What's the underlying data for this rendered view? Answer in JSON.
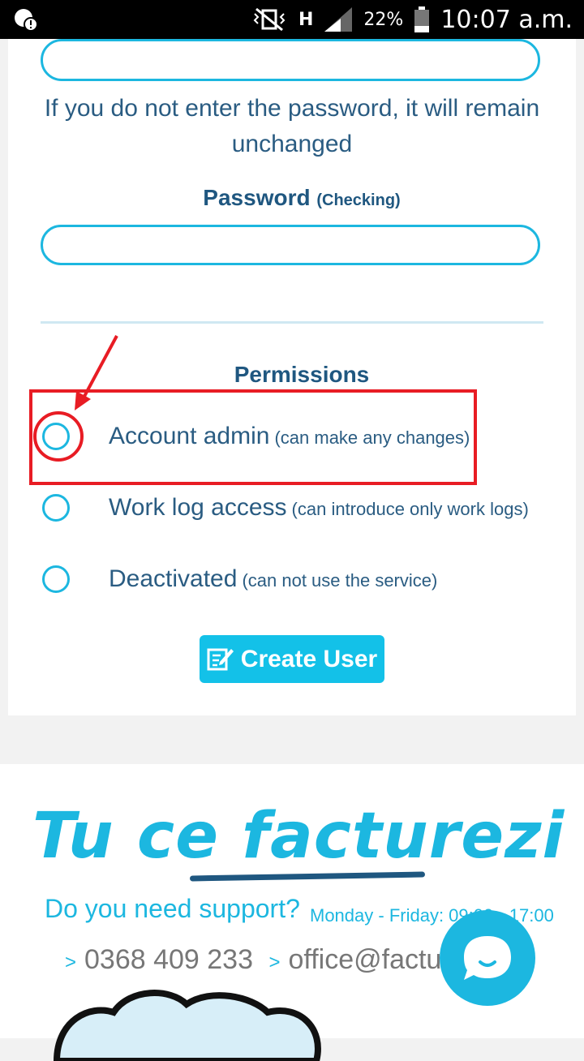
{
  "status_bar": {
    "battery": "22%",
    "time": "10:07 a.m.",
    "network_indicator": "H"
  },
  "form": {
    "password_note": "If you do not enter the password, it will remain unchanged",
    "password_check_label": "Password",
    "password_check_sub": "(Checking)",
    "password_value": "",
    "password_check_value": "",
    "permissions_title": "Permissions",
    "options": [
      {
        "label": "Account admin",
        "sub": "(can make any changes)"
      },
      {
        "label": "Work log access",
        "sub": "(can introduce only work logs)"
      },
      {
        "label": "Deactivated",
        "sub": "(can not use the service)"
      }
    ],
    "create_button": "Create User"
  },
  "annotation": {
    "color": "#e81c24"
  },
  "footer": {
    "brand": "Tu ce facturezi azi ?",
    "support_text": "Do you need support?",
    "hours": "Monday - Friday: 09:00 - 17:00",
    "phone": "0368 409 233",
    "email": "office@facturezi.ro",
    "chevron": ">"
  },
  "colors": {
    "accent": "#1cb7e0",
    "text": "#2a5c82",
    "button": "#13c1e8"
  }
}
